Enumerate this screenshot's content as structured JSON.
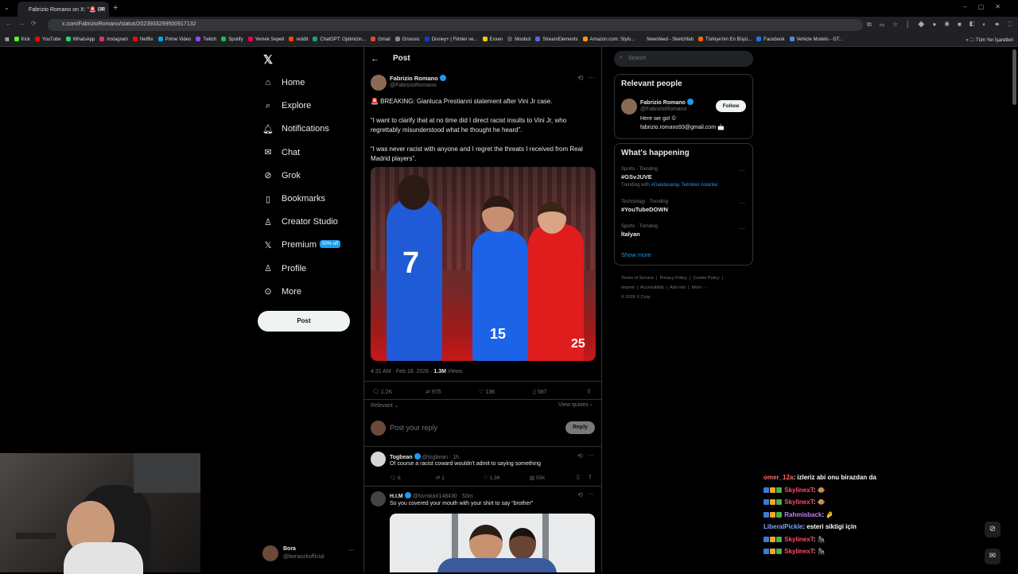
{
  "browser": {
    "tab_title": "Fabrizio Romano on X: \"🚨 BR",
    "url": "x.com/FabrizioRomano/status/2023933299500917132",
    "bookmarks": [
      "Kick",
      "YouTube",
      "WhatsApp",
      "Instagram",
      "Netflix",
      "Prime Video",
      "Twitch",
      "Spotify",
      "Yemek Sepeti",
      "reddit",
      "ChatGPT: Optimizin...",
      "Gmail",
      "Gnoosic",
      "Disney+ | Filmler ve...",
      "Exxen",
      "Moobot",
      "StreamElements",
      "Amazon.com: Stylo...",
      "Newsfeed - Sketchfab",
      "Türkiye'nin En Büyü...",
      "Facebook",
      "Vehicle Models - GT..."
    ],
    "bookmark_colors": [
      "#53fc18",
      "#ff0000",
      "#25d366",
      "#e1306c",
      "#e50914",
      "#00a8e1",
      "#9146ff",
      "#1db954",
      "#ea004b",
      "#ff4500",
      "#10a37f",
      "#ea4335",
      "#888888",
      "#113ccf",
      "#ffcc00",
      "#555555",
      "#5865f2",
      "#ff9900",
      "#222222",
      "#ff6600",
      "#1877f2",
      "#4a90d9"
    ],
    "all_bookmarks": "Tüm Yer İşaretleri"
  },
  "nav": {
    "items": [
      {
        "label": "Home",
        "icon": "home-icon"
      },
      {
        "label": "Explore",
        "icon": "search-icon"
      },
      {
        "label": "Notifications",
        "icon": "bell-icon"
      },
      {
        "label": "Chat",
        "icon": "mail-icon"
      },
      {
        "label": "Grok",
        "icon": "grok-icon"
      },
      {
        "label": "Bookmarks",
        "icon": "bookmark-icon"
      },
      {
        "label": "Creator Studio",
        "icon": "creator-icon"
      },
      {
        "label": "Premium",
        "icon": "x-icon"
      },
      {
        "label": "Profile",
        "icon": "person-icon"
      },
      {
        "label": "More",
        "icon": "more-circle-icon"
      }
    ],
    "premium_badge": "50% off",
    "post_button": "Post",
    "account_name": "Bora",
    "account_handle": "@boraozkofficial"
  },
  "header": {
    "title": "Post"
  },
  "tweet": {
    "author": "Fabrizio Romano",
    "handle": "@FabrizioRomano",
    "lines": [
      "🚨 BREAKING: Gianluca Prestianni statement after Vini Jr case.",
      "“I want to clarify that at no time did I direct racist insults to Vini Jr, who regrettably misunderstood what he thought he heard”.",
      "“I was never racist with anyone and I regret the threats I received from Real Madrid players”."
    ],
    "meta_time": "4:31 AM · Feb 18, 2026 · ",
    "views": "1.3M",
    "views_label": " Views",
    "replies": "1.2K",
    "reposts": "975",
    "likes": "13K",
    "bookmarks": "587",
    "relevant": "Relevant ⌄",
    "view_quotes": "View quotes ›",
    "reply_placeholder": "Post your reply",
    "reply_button": "Reply"
  },
  "replies": [
    {
      "name": "Togbean",
      "handle": "@togbean · 1h",
      "text": "Of course a racist coward wouldn't admit to saying something",
      "replies": "6",
      "reposts": "1",
      "likes": "1.3K",
      "views": "55K"
    },
    {
      "name": "H.I.M",
      "handle": "@Nvmkari148430 · 53m",
      "text": "So you covered your mouth with your shirt to say “brother”"
    }
  ],
  "search": {
    "placeholder": "Search"
  },
  "relevant": {
    "title": "Relevant people",
    "name": "Fabrizio Romano",
    "handle": "@FabrizioRomano",
    "follow": "Follow",
    "bio": "Here we go! ©",
    "email": "fabrizio.romano93@gmail.com 📩"
  },
  "happening": {
    "title": "What's happening",
    "trends": [
      {
        "context": "Sports · Trending",
        "name": "#GSvJUVE",
        "extra_prefix": "Trending with ",
        "extra": "#Galatasaray, Tebrikler Aslanlar"
      },
      {
        "context": "Technology · Trending",
        "name": "#YouTubeDOWN",
        "extra_prefix": "",
        "extra": ""
      },
      {
        "context": "Sports · Trending",
        "name": "İtalyan",
        "extra_prefix": "",
        "extra": ""
      }
    ],
    "show_more": "Show more"
  },
  "footer": {
    "row1": "Terms of Service  |  Privacy Policy  |  Cookie Policy  |",
    "row2": "Imprint  |  Accessibility  |  Ads info  |  More ···",
    "row3": "© 2026 X Corp."
  },
  "chat": [
    {
      "user": "omer_12a",
      "color": "#ff6b6b",
      "msg": ": izleriz abi onu birazdan da",
      "badges": false
    },
    {
      "user": "SkylinexT",
      "color": "#ff4d6d",
      "msg": ": 🐵",
      "badges": true
    },
    {
      "user": "SkylinexT",
      "color": "#ff4d6d",
      "msg": ": 🐵",
      "badges": true
    },
    {
      "user": "Rahmisback",
      "color": "#c77dff",
      "msg": ": 🤌",
      "badges": true
    },
    {
      "user": "LiberalPickle",
      "color": "#7aa7ff",
      "msg": ": esteri siktigi için",
      "badges": false
    },
    {
      "user": "SkylinexT",
      "color": "#ff4d6d",
      "msg": ": 🦍",
      "badges": true
    },
    {
      "user": "SkylinexT",
      "color": "#ff4d6d",
      "msg": ": 🦍",
      "badges": true
    }
  ]
}
